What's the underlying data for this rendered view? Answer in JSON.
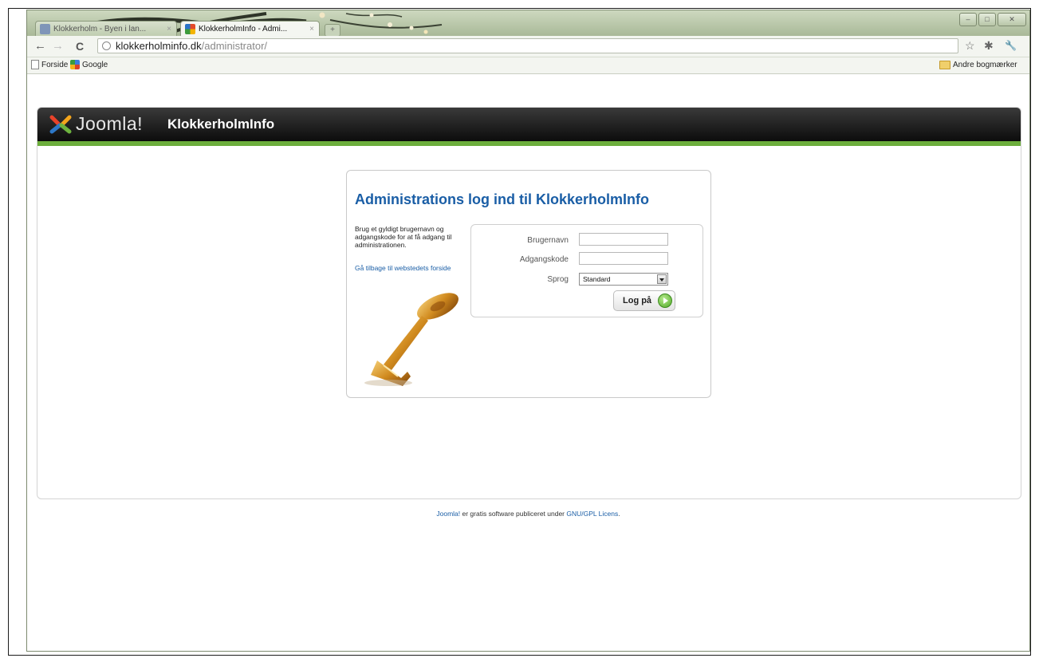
{
  "browser": {
    "tabs": [
      {
        "title": "Klokkerholm - Byen i lan...",
        "active": false
      },
      {
        "title": "KlokkerholmInfo - Admi...",
        "active": true
      }
    ],
    "new_tab_symbol": "+",
    "close_symbol": "×",
    "window_buttons": {
      "minimize": "–",
      "maximize": "□",
      "close": "✕"
    },
    "nav": {
      "back": "←",
      "forward": "→",
      "reload": "C"
    },
    "url_host": "klokkerholminfo.dk",
    "url_path": "/administrator/",
    "toolbar_icons": {
      "star": "☆",
      "extensions": "✱",
      "wrench": "🔧"
    },
    "bookmarks": [
      {
        "label": "Forside",
        "icon": "page-icon"
      },
      {
        "label": "Google",
        "icon": "google-icon"
      }
    ],
    "other_bookmarks": "Andre bogmærker",
    "accent": "#b9c5ab"
  },
  "joomla": {
    "logo_text": "Joomla!",
    "site_name": "KlokkerholmInfo",
    "header_accent": "#6cae3c"
  },
  "login": {
    "title": "Administrations log ind til KlokkerholmInfo",
    "description": "Brug et gyldigt brugernavn og adgangskode for at få adgang til administrationen.",
    "back_link": "Gå tilbage til webstedets forside",
    "username_label": "Brugernavn",
    "username_value": "",
    "password_label": "Adgangskode",
    "password_value": "",
    "language_label": "Sprog",
    "language_value": "Standard",
    "submit_label": "Log på",
    "title_color": "#1a5ea6"
  },
  "footer": {
    "joomla_link": "Joomla!",
    "text": " er gratis software publiceret under ",
    "license_link": "GNU/GPL Licens",
    "end": "."
  }
}
